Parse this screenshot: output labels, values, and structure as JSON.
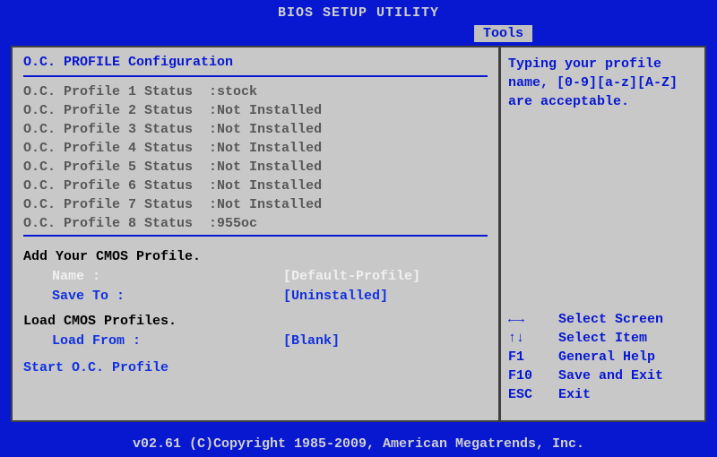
{
  "header": {
    "title": "BIOS SETUP UTILITY",
    "active_tab": "Tools"
  },
  "main": {
    "section_title": "O.C. PROFILE Configuration",
    "profiles": [
      {
        "label": "O.C. Profile 1 Status  :",
        "status": "stock"
      },
      {
        "label": "O.C. Profile 2 Status  :",
        "status": "Not Installed"
      },
      {
        "label": "O.C. Profile 3 Status  :",
        "status": "Not Installed"
      },
      {
        "label": "O.C. Profile 4 Status  :",
        "status": "Not Installed"
      },
      {
        "label": "O.C. Profile 5 Status  :",
        "status": "Not Installed"
      },
      {
        "label": "O.C. Profile 6 Status  :",
        "status": "Not Installed"
      },
      {
        "label": "O.C. Profile 7 Status  :",
        "status": "Not Installed"
      },
      {
        "label": "O.C. Profile 8 Status  :",
        "status": "955oc"
      }
    ],
    "add_section": {
      "title": "Add Your CMOS Profile.",
      "name_label": "Name :",
      "name_value": "[Default-Profile]",
      "saveto_label": "Save To :",
      "saveto_value": "[Uninstalled]"
    },
    "load_section": {
      "title": "Load CMOS Profiles.",
      "loadfrom_label": "Load From :",
      "loadfrom_value": "[Blank]"
    },
    "start_label": "Start O.C. Profile"
  },
  "help": {
    "text_line1": "Typing your profile",
    "text_line2": "name, [0-9][a-z][A-Z]",
    "text_line3": "are acceptable.",
    "keys": [
      {
        "glyph": "←→",
        "desc": "Select Screen"
      },
      {
        "glyph": "↑↓",
        "desc": "Select Item"
      },
      {
        "glyph": "F1",
        "desc": "General Help"
      },
      {
        "glyph": "F10",
        "desc": "Save and Exit"
      },
      {
        "glyph": "ESC",
        "desc": "Exit"
      }
    ]
  },
  "footer": {
    "copyright": "v02.61 (C)Copyright 1985-2009, American Megatrends, Inc."
  }
}
